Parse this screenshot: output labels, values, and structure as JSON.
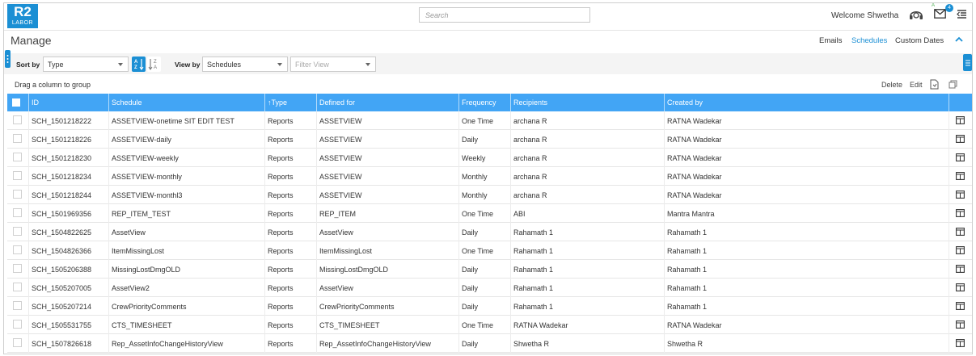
{
  "header": {
    "logo_big": "R2",
    "logo_small": "LABOR",
    "search_placeholder": "Search",
    "welcome": "Welcome Shwetha",
    "notification_count": "4",
    "icons": [
      "support-headset-icon",
      "mail-icon",
      "menu-collapse-icon"
    ]
  },
  "page": {
    "title": "Manage",
    "tabs": [
      {
        "label": "Emails",
        "active": false
      },
      {
        "label": "Schedules",
        "active": true
      },
      {
        "label": "Custom Dates",
        "active": false
      }
    ]
  },
  "toolbar": {
    "sort_label": "Sort by",
    "sort_value": "Type",
    "view_label": "View by",
    "view_value": "Schedules",
    "filter_placeholder": "Filter View"
  },
  "groupbar": {
    "drag_text": "Drag a column to group",
    "delete": "Delete",
    "edit": "Edit"
  },
  "table": {
    "columns": [
      "ID",
      "Schedule",
      "Type",
      "Defined for",
      "Frequency",
      "Recipients",
      "Created by"
    ],
    "sorted_column": "Type",
    "rows": [
      [
        "SCH_1501218222",
        "ASSETVIEW-onetime SIT EDIT TEST",
        "Reports",
        "ASSETVIEW",
        "One Time",
        "archana R",
        "RATNA Wadekar"
      ],
      [
        "SCH_1501218226",
        "ASSETVIEW-daily",
        "Reports",
        "ASSETVIEW",
        "Daily",
        "archana R",
        "RATNA Wadekar"
      ],
      [
        "SCH_1501218230",
        "ASSETVIEW-weekly",
        "Reports",
        "ASSETVIEW",
        "Weekly",
        "archana R",
        "RATNA Wadekar"
      ],
      [
        "SCH_1501218234",
        "ASSETVIEW-monthly",
        "Reports",
        "ASSETVIEW",
        "Monthly",
        "archana R",
        "RATNA Wadekar"
      ],
      [
        "SCH_1501218244",
        "ASSETVIEW-monthl3",
        "Reports",
        "ASSETVIEW",
        "Monthly",
        "archana R",
        "RATNA Wadekar"
      ],
      [
        "SCH_1501969356",
        "REP_ITEM_TEST",
        "Reports",
        "REP_ITEM",
        "One Time",
        "ABI",
        "Mantra Mantra"
      ],
      [
        "SCH_1504822625",
        "AssetView",
        "Reports",
        "AssetView",
        "Daily",
        "Rahamath 1",
        "Rahamath 1"
      ],
      [
        "SCH_1504826366",
        "ItemMissingLost",
        "Reports",
        "ItemMissingLost",
        "One Time",
        "Rahamath 1",
        "Rahamath 1"
      ],
      [
        "SCH_1505206388",
        "MissingLostDmgOLD",
        "Reports",
        "MissingLostDmgOLD",
        "Daily",
        "Rahamath 1",
        "Rahamath 1"
      ],
      [
        "SCH_1505207005",
        "AssetView2",
        "Reports",
        "AssetView",
        "Daily",
        "Rahamath 1",
        "Rahamath 1"
      ],
      [
        "SCH_1505207214",
        "CrewPriorityComments",
        "Reports",
        "CrewPriorityComments",
        "Daily",
        "Rahamath 1",
        "Rahamath 1"
      ],
      [
        "SCH_1505531755",
        "CTS_TIMESHEET",
        "Reports",
        "CTS_TIMESHEET",
        "One Time",
        "RATNA Wadekar",
        "RATNA Wadekar"
      ],
      [
        "SCH_1507826618",
        "Rep_AssetInfoChangeHistoryView",
        "Reports",
        "Rep_AssetInfoChangeHistoryView",
        "Daily",
        "Shwetha R",
        "Shwetha R"
      ]
    ]
  },
  "colors": {
    "brand": "#1b8fd4",
    "header_row": "#42a5f5",
    "active_tab": "#1b8fd4"
  }
}
